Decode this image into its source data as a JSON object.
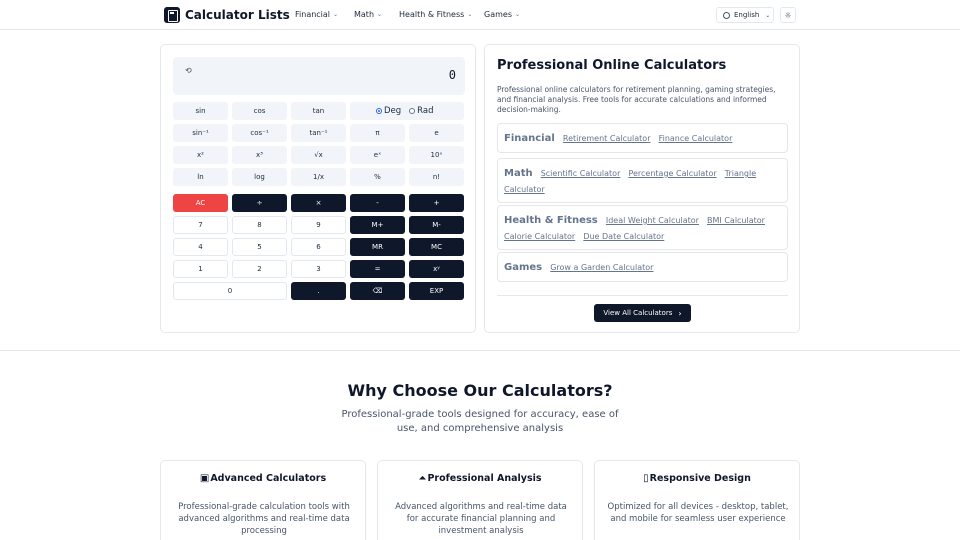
{
  "header": {
    "logo_text": "Calculator Lists",
    "nav": [
      {
        "label": "Financial"
      },
      {
        "label": "Math"
      },
      {
        "label": "Health & Fitness"
      },
      {
        "label": "Games"
      }
    ],
    "language": "English",
    "icons": {
      "logo": "calculator-icon",
      "language": "globe-icon",
      "theme": "sun-icon",
      "dropdown": "chevron-down-icon"
    }
  },
  "calculator": {
    "display_value": "0",
    "history_icon": "history-icon",
    "deg_label": "Deg",
    "rad_label": "Rad",
    "angle_mode": "Deg",
    "rows": [
      [
        "sin",
        "cos",
        "tan"
      ],
      [
        "sin⁻¹",
        "cos⁻¹",
        "tan⁻¹",
        "π",
        "e"
      ],
      [
        "x²",
        "x³",
        "√x",
        "eˣ",
        "10ˣ"
      ],
      [
        "ln",
        "log",
        "1/x",
        "%",
        "n!"
      ],
      [
        "AC",
        "÷",
        "×",
        "-",
        "+"
      ],
      [
        "7",
        "8",
        "9",
        "M+",
        "M-"
      ],
      [
        "4",
        "5",
        "6",
        "MR",
        "MC"
      ],
      [
        "1",
        "2",
        "3",
        "=",
        "xʸ"
      ],
      [
        "0",
        ".",
        "⌫",
        "EXP"
      ]
    ]
  },
  "info": {
    "title": "Professional Online Calculators",
    "description": "Professional online calculators for retirement planning, gaming strategies, and financial analysis. Free tools for accurate calculations and informed decision-making.",
    "categories": [
      {
        "name": "Financial",
        "links": [
          "Retirement Calculator",
          "Finance Calculator"
        ]
      },
      {
        "name": "Math",
        "links": [
          "Scientific Calculator",
          "Percentage Calculator",
          "Triangle Calculator"
        ]
      },
      {
        "name": "Health & Fitness",
        "links": [
          "Ideal Weight Calculator",
          "BMI Calculator",
          "Calorie Calculator",
          "Due Date Calculator"
        ]
      },
      {
        "name": "Games",
        "links": [
          "Grow a Garden Calculator"
        ]
      }
    ],
    "view_all_label": "View All Calculators"
  },
  "why": {
    "title": "Why Choose Our Calculators?",
    "subtitle": "Professional-grade tools designed for accuracy, ease of use, and comprehensive analysis",
    "features": [
      {
        "title": "Advanced Calculators",
        "icon": "calculator-icon",
        "text": "Professional-grade calculation tools with advanced algorithms and real-time data processing"
      },
      {
        "title": "Professional Analysis",
        "icon": "chart-icon",
        "text": "Advanced algorithms and real-time data for accurate financial planning and investment analysis"
      },
      {
        "title": "Responsive Design",
        "icon": "smartphone-icon",
        "text": "Optimized for all devices - desktop, tablet, and mobile for seamless user experience"
      }
    ]
  },
  "colors": {
    "primary": "#0f172a",
    "danger": "#ef4444",
    "muted": "#f1f5f9",
    "border": "#e5e7eb",
    "radio": "#2563eb"
  }
}
